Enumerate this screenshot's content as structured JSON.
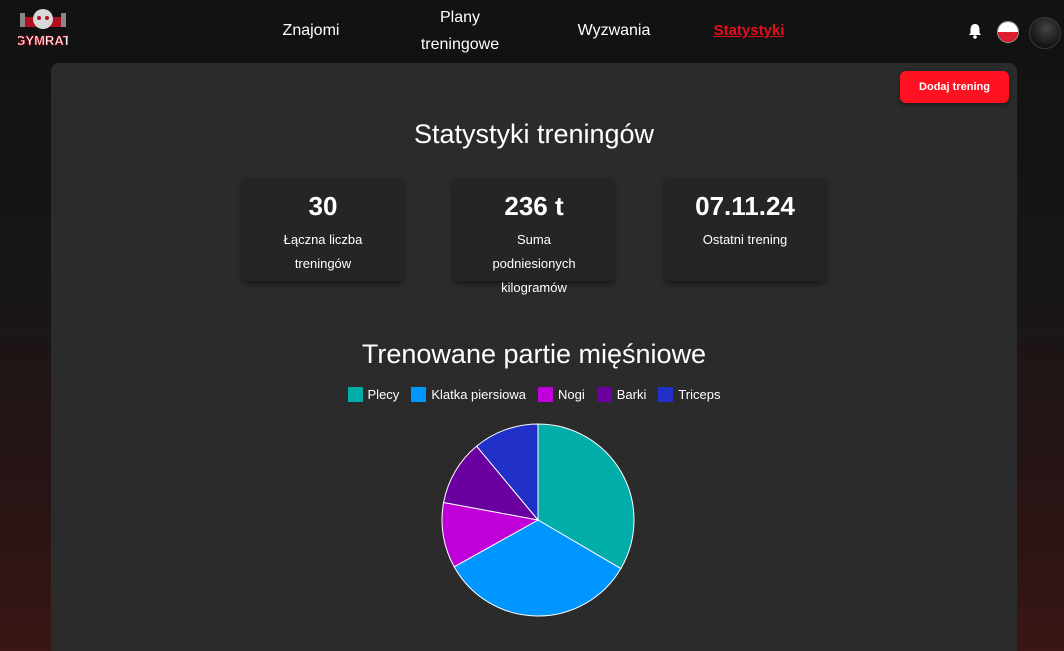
{
  "app": {
    "logo_text": "GYMRAT"
  },
  "nav": {
    "items": [
      {
        "label": "Znajomi"
      },
      {
        "label_line1": "Plany",
        "label_line2": "treningowe"
      },
      {
        "label": "Wyzwania"
      },
      {
        "label": "Statystyki",
        "active": true
      }
    ]
  },
  "header_icons": [
    "bell-icon",
    "flag-pl-icon",
    "avatar"
  ],
  "colors": {
    "accent": "#ff1121",
    "active_nav": "#e30d1c",
    "panel": "#2b2b2b",
    "card": "#252525"
  },
  "actions": {
    "add_training": "Dodaj trening"
  },
  "stats": {
    "title": "Statystyki treningów",
    "cards": [
      {
        "value": "30",
        "label_line1": "Łączna liczba",
        "label_line2": "treningów"
      },
      {
        "value": "236 t",
        "label_line1": "Suma podniesionych",
        "label_line2": "kilogramów"
      },
      {
        "value": "07.11.24",
        "label_line1": "Ostatni trening",
        "label_line2": ""
      }
    ]
  },
  "muscles": {
    "title": "Trenowane partie mięśniowe"
  },
  "chart_data": {
    "type": "pie",
    "title": "Trenowane partie mięśniowe",
    "legend_position": "top",
    "labels": [
      "Plecy",
      "Klatka piersiowa",
      "Nogi",
      "Barki",
      "Triceps"
    ],
    "values": [
      10,
      10,
      3.3,
      3.3,
      3.3
    ],
    "colors": [
      "#00ada8",
      "#0096ff",
      "#c000d8",
      "#6a00a0",
      "#2030c8"
    ]
  }
}
